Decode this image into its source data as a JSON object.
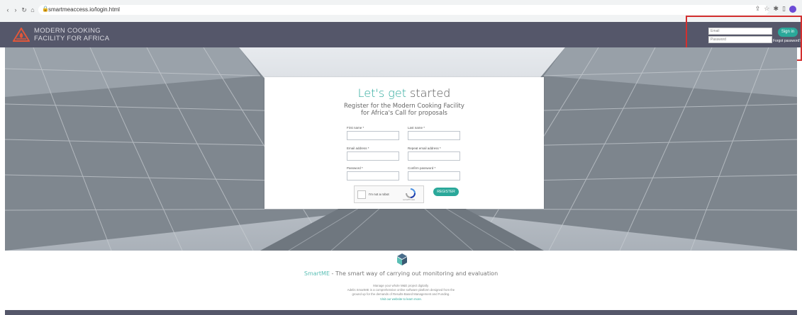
{
  "browser": {
    "url": "smartmeaccess.io/login.html",
    "back_glyph": "‹",
    "forward_glyph": "›",
    "reload_glyph": "↻",
    "home_glyph": "⌂",
    "lock_glyph": "🔒",
    "share_glyph": "⇪",
    "star_glyph": "☆",
    "ext_glyph": "✱",
    "sidebar_glyph": "▯"
  },
  "header": {
    "logo_line1": "MODERN COOKING",
    "logo_line2": "FACILITY FOR AFRICA",
    "email_placeholder": "Email",
    "password_placeholder": "Password",
    "signin_label": "Sign in",
    "forgot_label": "Forgot password?"
  },
  "card": {
    "title_accent": "Let's get",
    "title_rest": " started",
    "subtitle_line1": "Register for the Modern Cooking Facility",
    "subtitle_line2": "for Africa's Call for proposals",
    "first_name_label": "First name *",
    "last_name_label": "Last name *",
    "email_label": "Email address *",
    "repeat_email_label": "Repeat email address *",
    "password_label": "Password *",
    "confirm_password_label": "Confirm password *",
    "captcha_label": "I'm not a robot",
    "captcha_brand": "reCAPTCHA",
    "register_label": "REGISTER"
  },
  "footer": {
    "brand": "SmartME",
    "tagline_rest": " - The smart way of carrying out monitoring and evaluation",
    "desc_line1": "Manage your whole M&E project digitally.",
    "desc_line2": "Adelis SmartME is a comprehensive online software platform designed from the",
    "desc_line3": "ground up for the demands of Results-Based Management and Funding.",
    "desc_link": "Visit our website to learn more."
  },
  "colors": {
    "accent": "#2aa89a",
    "header_bg": "#55576a",
    "highlight_border": "#d32f2f"
  }
}
